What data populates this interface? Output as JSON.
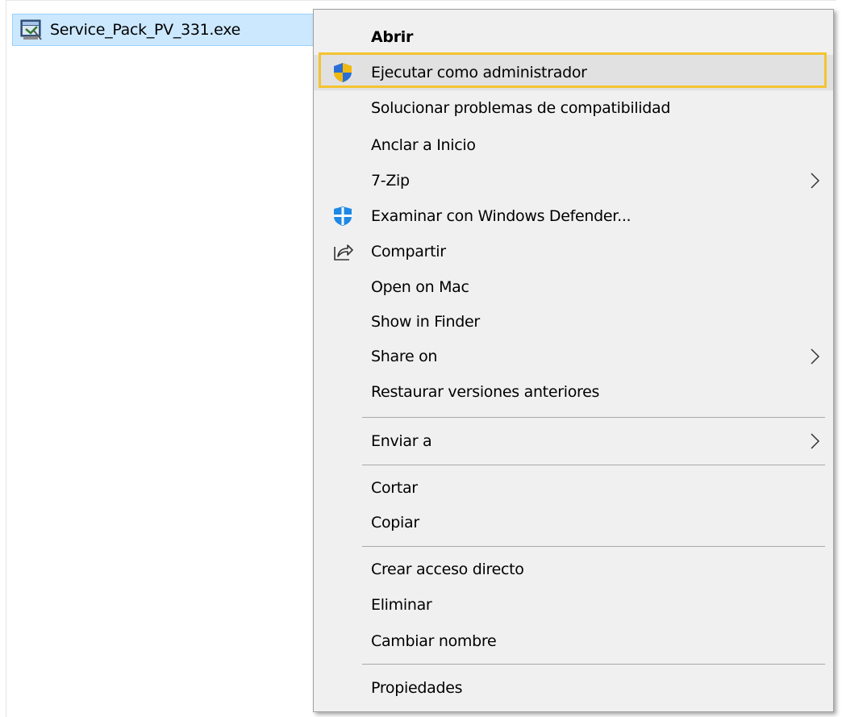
{
  "file": {
    "name": "Service_Pack_PV_331.exe",
    "icon": "installer-icon"
  },
  "context_menu": {
    "items": [
      {
        "label": "Abrir",
        "bold": true
      },
      {
        "label": "Ejecutar como administrador",
        "icon": "uac-shield-icon",
        "highlighted": true
      },
      {
        "label": "Solucionar problemas de compatibilidad"
      },
      {
        "label": "Anclar a Inicio"
      },
      {
        "label": "7-Zip",
        "submenu": true
      },
      {
        "label": "Examinar con Windows Defender...",
        "icon": "windows-defender-icon"
      },
      {
        "label": "Compartir",
        "icon": "share-icon"
      },
      {
        "label": "Open on Mac"
      },
      {
        "label": "Show in Finder"
      },
      {
        "label": "Share on",
        "submenu": true
      },
      {
        "label": "Restaurar versiones anteriores"
      },
      {
        "label": "Enviar a",
        "submenu": true
      },
      {
        "label": "Cortar"
      },
      {
        "label": "Copiar"
      },
      {
        "label": "Crear acceso directo"
      },
      {
        "label": "Eliminar"
      },
      {
        "label": "Cambiar nombre"
      },
      {
        "label": "Propiedades"
      }
    ]
  },
  "colors": {
    "selection_background": "#cce8ff",
    "menu_background": "#f0f0f0",
    "highlight_outline": "#f4c430"
  }
}
